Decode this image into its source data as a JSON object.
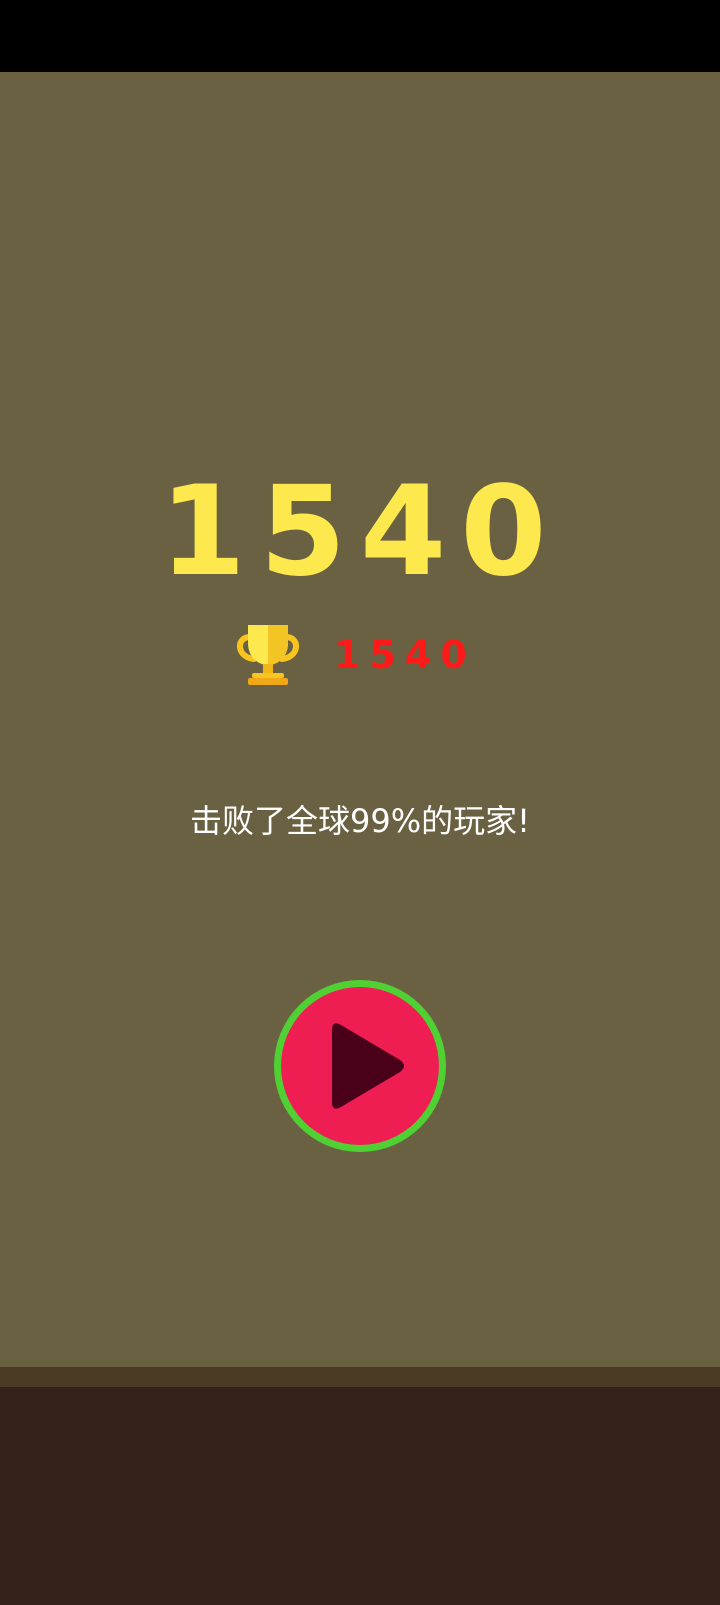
{
  "game": {
    "score": "1540",
    "best_score": "1540",
    "rank_message": "击败了全球99%的玩家!"
  },
  "icons": {
    "trophy": "trophy-icon",
    "play": "play-icon"
  },
  "colors": {
    "background": "#6a6142",
    "score": "#fde84e",
    "best_score": "#ff1a1a",
    "play_button_fill": "#ee1d52",
    "play_button_ring": "#4fd133",
    "play_triangle": "#4a0019",
    "ground": "#33231a"
  }
}
